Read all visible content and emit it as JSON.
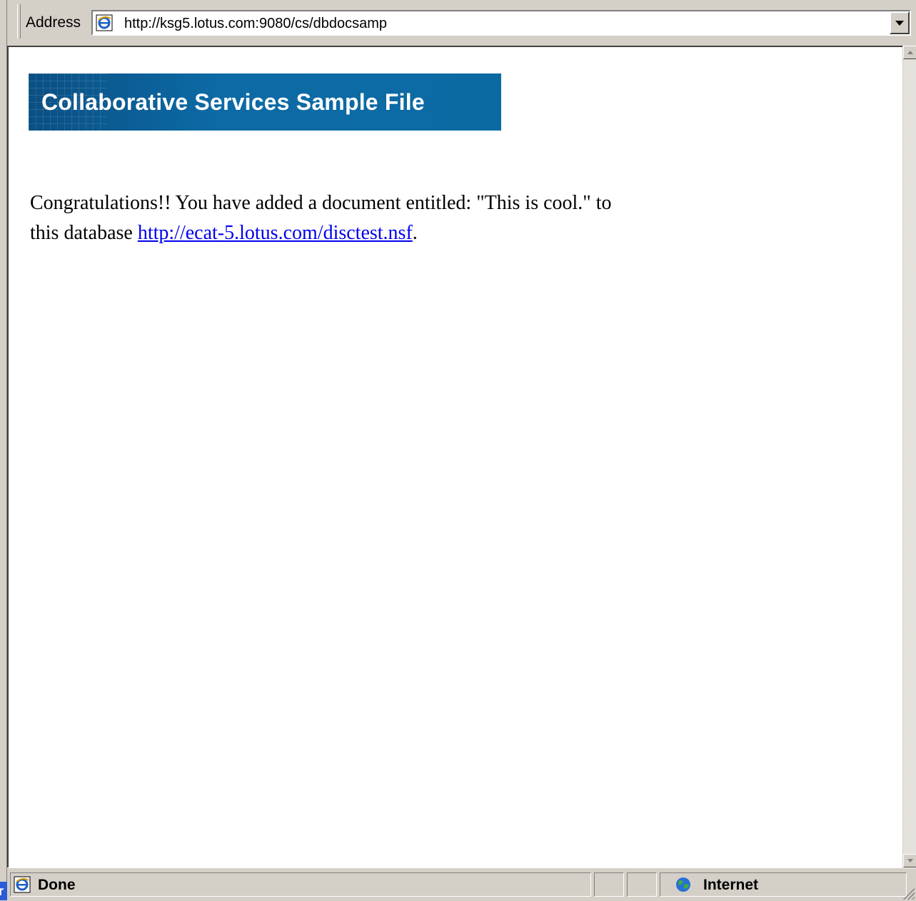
{
  "address_bar": {
    "label": "Address",
    "url": "http://ksg5.lotus.com:9080/cs/dbdocsamp"
  },
  "page": {
    "banner_title": "Collaborative Services Sample File",
    "message_text": "Congratulations!! You have added a document entitled: \"This is cool.\" to this database ",
    "message_link": "http://ecat-5.lotus.com/disctest.nsf",
    "message_tail": "."
  },
  "status_bar": {
    "status": "Done",
    "zone": "Internet"
  },
  "corner_tag": "r",
  "icons": [
    "ie-page-icon",
    "globe-icon",
    "dropdown-arrow-icon"
  ],
  "colors": {
    "banner": "#0c6aa3",
    "link": "#0000ee",
    "chrome": "#d4d0c8"
  }
}
